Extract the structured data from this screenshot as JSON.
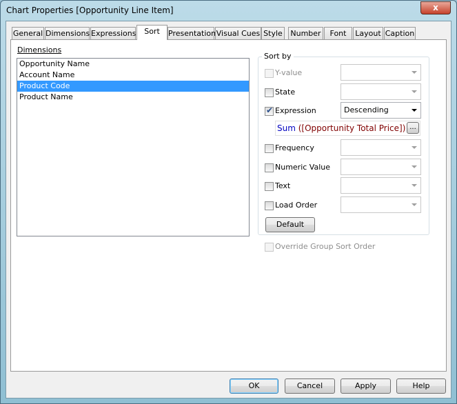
{
  "window": {
    "title": "Chart Properties [Opportunity Line Item]",
    "close": "x"
  },
  "tabs": [
    "General",
    "Dimensions",
    "Expressions",
    "Sort",
    "Presentation",
    "Visual Cues",
    "Style",
    "Number",
    "Font",
    "Layout",
    "Caption"
  ],
  "active_tab": "Sort",
  "dimensions": {
    "label": "Dimensions",
    "items": [
      "Opportunity Name",
      "Account Name",
      "Product Code",
      "Product Name"
    ],
    "selected": "Product Code"
  },
  "sort_by": {
    "label": "Sort by",
    "options": [
      {
        "label": "Y-value",
        "checked": false,
        "enabled": false,
        "value": ""
      },
      {
        "label": "State",
        "checked": false,
        "enabled": true,
        "value": ""
      },
      {
        "label": "Expression",
        "checked": true,
        "enabled": true,
        "value": "Descending"
      },
      {
        "label": "Frequency",
        "checked": false,
        "enabled": true,
        "value": ""
      },
      {
        "label": "Numeric Value",
        "checked": false,
        "enabled": true,
        "value": ""
      },
      {
        "label": "Text",
        "checked": false,
        "enabled": true,
        "value": ""
      },
      {
        "label": "Load Order",
        "checked": false,
        "enabled": true,
        "value": ""
      }
    ],
    "expression": {
      "func": "Sum",
      "args": " ([Opportunity Total Price])",
      "func_color": "#0000c0",
      "field_color": "#800000"
    },
    "ellipsis": "...",
    "default_button": "Default"
  },
  "override": {
    "label": "Override Group Sort Order",
    "checked": false,
    "enabled": false
  },
  "buttons": {
    "ok": "OK",
    "cancel": "Cancel",
    "apply": "Apply",
    "help": "Help"
  }
}
